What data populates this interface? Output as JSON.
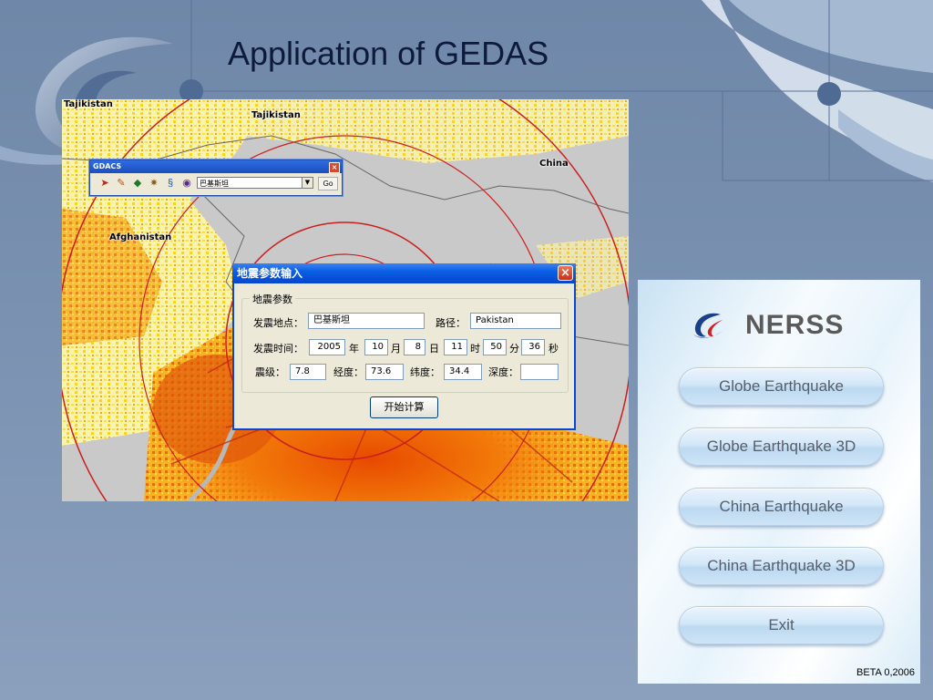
{
  "slide": {
    "title": "Application of GEDAS"
  },
  "map": {
    "labels": {
      "tajikistan_left": "Tajikistan",
      "tajikistan_top": "Tajikistan",
      "china": "China",
      "afghanistan": "Afghanistan"
    }
  },
  "gdacs_toolbar": {
    "title": "GDACS",
    "location_select": "巴基斯坦",
    "go_label": "Go",
    "tools": [
      "pin-icon",
      "pointer-icon",
      "layers-icon",
      "compass-icon",
      "refresh-icon",
      "globe-icon"
    ]
  },
  "param_dialog": {
    "title": "地震参数输入",
    "group_label": "地震参数",
    "location_label": "发震地点：",
    "location_value": "巴基斯坦",
    "path_label": "路径：",
    "path_value": "Pakistan",
    "time_label": "发震时间：",
    "year": "2005",
    "year_unit": "年",
    "month": "10",
    "month_unit": "月",
    "day": "8",
    "day_unit": "日",
    "hour": "11",
    "hour_unit": "时",
    "minute": "50",
    "minute_unit": "分",
    "second": "36",
    "second_unit": "秒",
    "magnitude_label": "震级：",
    "magnitude": "7.8",
    "longitude_label": "经度：",
    "longitude": "73.6",
    "latitude_label": "纬度：",
    "latitude": "34.4",
    "depth_label": "深度：",
    "depth": "",
    "compute_button": "开始计算"
  },
  "nerss": {
    "app_name": "NERSS",
    "buttons": [
      "Globe Earthquake",
      "Globe Earthquake 3D",
      "China Earthquake",
      "China Earthquake 3D",
      "Exit"
    ],
    "version": "BETA 0,2006"
  },
  "colors": {
    "dialog_title": "#0a5fe6",
    "map_low": "#ffe04a",
    "map_high": "#e24a00",
    "circle": "#cc1e1e"
  }
}
